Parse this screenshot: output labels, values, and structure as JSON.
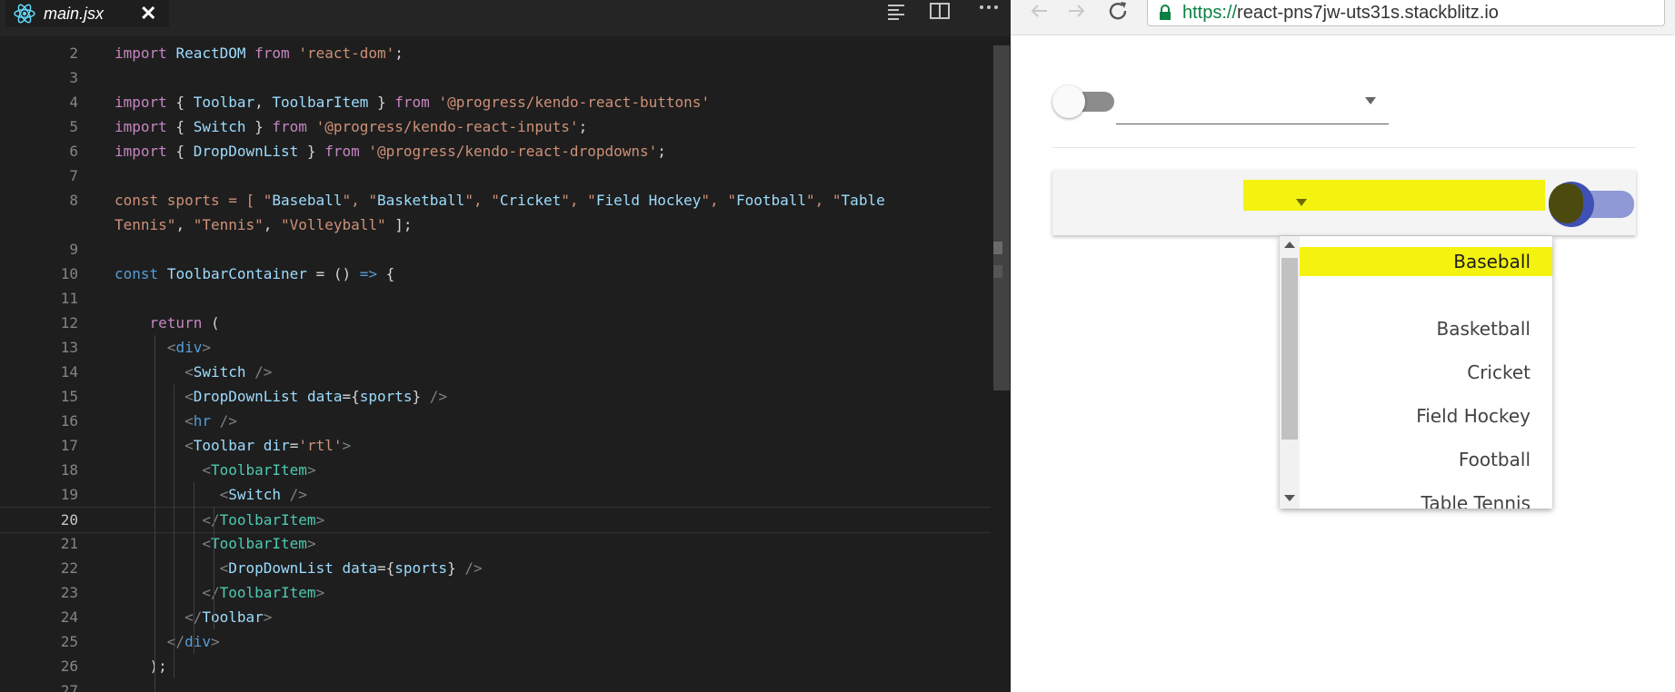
{
  "editor": {
    "tab": {
      "filename": "main.jsx",
      "close_glyph": "✕"
    },
    "toolbar_icons": [
      "align-left-icon",
      "split-editor-icon",
      "more-icon"
    ],
    "colors": {
      "background": "#1e1e1e",
      "keyword": "#c586c0",
      "identifier": "#9cdcfe",
      "string": "#ce9178",
      "tag": "#4ec9b0",
      "punct": "#808080",
      "storage": "#569cd6"
    },
    "lines": [
      {
        "n": "2",
        "text": "import ReactDOM from 'react-dom';"
      },
      {
        "n": "3",
        "text": ""
      },
      {
        "n": "4",
        "text": "import { Toolbar, ToolbarItem } from '@progress/kendo-react-buttons'"
      },
      {
        "n": "5",
        "text": "import { Switch } from '@progress/kendo-react-inputs';"
      },
      {
        "n": "6",
        "text": "import { DropDownList } from '@progress/kendo-react-dropdowns';"
      },
      {
        "n": "7",
        "text": ""
      },
      {
        "n": "8",
        "text": "const sports = [ \"Baseball\", \"Basketball\", \"Cricket\", \"Field Hockey\", \"Football\", \"Table"
      },
      {
        "n": "",
        "text": "Tennis\", \"Tennis\", \"Volleyball\" ];"
      },
      {
        "n": "9",
        "text": ""
      },
      {
        "n": "10",
        "text": "const ToolbarContainer = () => {"
      },
      {
        "n": "11",
        "text": ""
      },
      {
        "n": "12",
        "text": "    return ("
      },
      {
        "n": "13",
        "text": "      <div>"
      },
      {
        "n": "14",
        "text": "        <Switch />"
      },
      {
        "n": "15",
        "text": "        <DropDownList data={sports} />"
      },
      {
        "n": "16",
        "text": "        <hr />"
      },
      {
        "n": "17",
        "text": "        <Toolbar dir='rtl'>"
      },
      {
        "n": "18",
        "text": "          <ToolbarItem>"
      },
      {
        "n": "19",
        "text": "            <Switch />"
      },
      {
        "n": "20",
        "text": "          </ToolbarItem>"
      },
      {
        "n": "21",
        "text": "          <ToolbarItem>"
      },
      {
        "n": "22",
        "text": "            <DropDownList data={sports} />"
      },
      {
        "n": "23",
        "text": "          </ToolbarItem>"
      },
      {
        "n": "24",
        "text": "        </Toolbar>"
      },
      {
        "n": "25",
        "text": "      </div>"
      },
      {
        "n": "26",
        "text": "    );"
      },
      {
        "n": "27",
        "text": ""
      }
    ],
    "current_line": "20"
  },
  "browser": {
    "url_scheme": "https://",
    "url_host": "react-pns7jw-uts31s.stackblitz.io",
    "nav_icons": [
      "back-icon",
      "forward-icon",
      "reload-icon",
      "lock-icon"
    ],
    "highlight_color": "#f4f30f",
    "switch1": {
      "state": "off"
    },
    "switch2": {
      "state": "on",
      "accent": "#3f51b5"
    },
    "dropdown1": {
      "value": ""
    },
    "options": [
      "Baseball",
      "Basketball",
      "Cricket",
      "Field Hockey",
      "Football",
      "Table Tennis"
    ],
    "selected_option": "Baseball"
  }
}
